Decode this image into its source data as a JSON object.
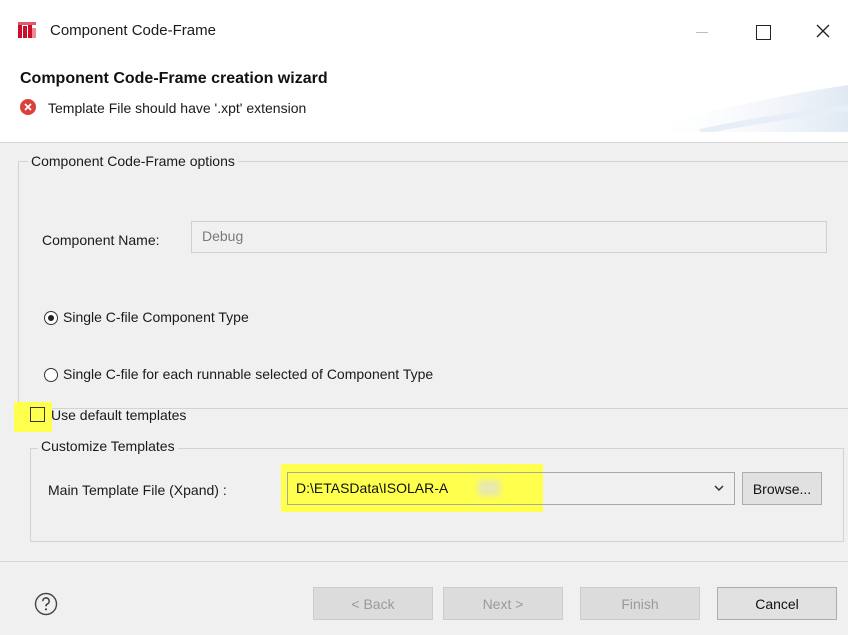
{
  "window": {
    "title": "Component Code-Frame",
    "app_icon": "etas-app-icon",
    "controls": [
      "minimize-icon",
      "maximize-icon",
      "close-icon"
    ]
  },
  "header": {
    "wizard_title": "Component Code-Frame creation wizard",
    "error_icon": "error-circle-icon",
    "error_message": "Template File should have '.xpt' extension"
  },
  "options_group": {
    "label": "Component Code-Frame options",
    "component_name_label": "Component Name:",
    "component_name_value": "Debug",
    "radio_single_label": "Single C-file Component Type",
    "radio_single_selected": true,
    "radio_each_label": "Single C-file for each runnable selected of Component Type",
    "radio_each_selected": false
  },
  "use_default_templates": {
    "label": "Use default templates",
    "checked": false
  },
  "customize_group": {
    "label": "Customize Templates",
    "main_template_label": "Main Template File (Xpand) :",
    "main_template_value": "D:\\ETASData\\ISOLAR-A",
    "browse_label": "Browse..."
  },
  "footer": {
    "help_icon": "help-icon",
    "back_label": "< Back",
    "next_label": "Next >",
    "finish_label": "Finish",
    "cancel_label": "Cancel"
  },
  "colors": {
    "highlight": "#ffff4d",
    "error_red": "#d9413a",
    "panel_bg": "#f0f0f0"
  }
}
